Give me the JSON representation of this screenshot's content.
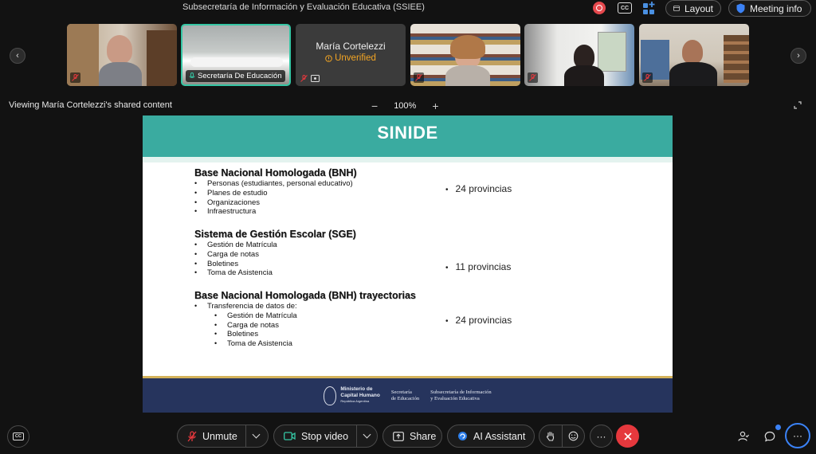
{
  "meeting": {
    "title": "Subsecretaría de Información y Evaluación Educativa (SSIEE)",
    "layout_label": "Layout",
    "info_label": "Meeting info"
  },
  "filmstrip": {
    "tiles": [
      {
        "type": "video",
        "label": "",
        "muted": true
      },
      {
        "type": "video",
        "label": "Secretaría De Educación",
        "muted": true,
        "active": true
      },
      {
        "type": "name",
        "name": "María Cortelezzi",
        "status": "Unverified",
        "muted": true
      },
      {
        "type": "video",
        "label": "",
        "muted": true
      },
      {
        "type": "video",
        "label": "",
        "muted": true
      },
      {
        "type": "video",
        "label": "",
        "muted": true
      }
    ]
  },
  "share_bar": {
    "viewing_text": "Viewing María Cortelezzi's shared content",
    "zoom_out": "−",
    "zoom_level": "100%",
    "zoom_in": "+"
  },
  "slide": {
    "title": "SINIDE",
    "sections": [
      {
        "heading": "Base Nacional Homologada (BNH)",
        "items": [
          "Personas (estudiantes, personal educativo)",
          "Planes de estudio",
          "Organizaciones",
          "Infraestructura"
        ],
        "provincias": "24 provincias"
      },
      {
        "heading": "Sistema de Gestión Escolar (SGE)",
        "items": [
          "Gestión de Matrícula",
          "Carga de notas",
          "Boletines",
          "Toma de Asistencia"
        ],
        "provincias": "11 provincias"
      },
      {
        "heading": "Base Nacional Homologada (BNH) trayectorias",
        "items": [
          "Transferencia de datos de:"
        ],
        "subitems": [
          "Gestión de Matrícula",
          "Carga de notas",
          "Boletines",
          "Toma de Asistencia"
        ],
        "provincias": "24 provincias"
      }
    ],
    "footer": {
      "org1_line1": "Ministerio de",
      "org1_line2": "Capital Humano",
      "org1_line3": "República Argentina",
      "org2_line1": "Secretaría",
      "org2_line2": "de Educación",
      "org3_line1": "Subsecretaría de Información",
      "org3_line2": "y Evaluación Educativa"
    }
  },
  "toolbar": {
    "unmute": "Unmute",
    "stop_video": "Stop video",
    "share": "Share",
    "ai_assistant": "AI Assistant",
    "more": "···",
    "more_right": "···"
  },
  "colors": {
    "accent_teal": "#3aaba0",
    "leave_red": "#e5383d",
    "unverified_orange": "#f5a623",
    "footer_navy": "#26345d"
  }
}
